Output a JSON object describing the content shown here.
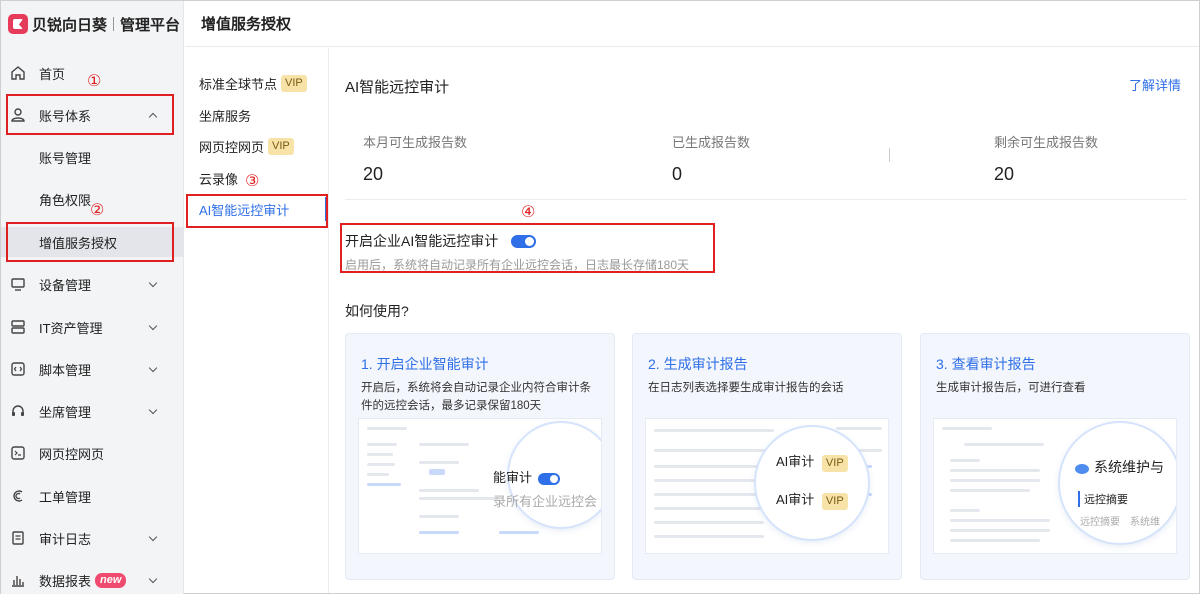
{
  "brand": {
    "name": "贝锐向日葵",
    "subtitle": "管理平台"
  },
  "header": {
    "title": "增值服务授权"
  },
  "sidebar": {
    "items": [
      {
        "label": "首页",
        "icon": "home-icon"
      },
      {
        "label": "账号体系",
        "icon": "user-icon",
        "expanded": true,
        "children": [
          "账号管理",
          "角色权限",
          "增值服务授权"
        ]
      },
      {
        "label": "设备管理",
        "icon": "monitor-icon"
      },
      {
        "label": "IT资产管理",
        "icon": "server-icon"
      },
      {
        "label": "脚本管理",
        "icon": "script-icon"
      },
      {
        "label": "坐席管理",
        "icon": "headset-icon"
      },
      {
        "label": "网页控网页",
        "icon": "terminal-icon"
      },
      {
        "label": "工单管理",
        "icon": "ticket-icon"
      },
      {
        "label": "审计日志",
        "icon": "document-icon"
      },
      {
        "label": "数据报表",
        "icon": "bar-chart-icon",
        "badge": "new"
      }
    ],
    "active_child": "增值服务授权"
  },
  "submenu": {
    "items": [
      {
        "label": "标准全球节点",
        "vip": "VIP"
      },
      {
        "label": "坐席服务"
      },
      {
        "label": "网页控网页",
        "vip": "VIP"
      },
      {
        "label": "云录像"
      },
      {
        "label": "AI智能远控审计",
        "active": true
      }
    ]
  },
  "main": {
    "section_title": "AI智能远控审计",
    "learn_more": "了解详情",
    "stats": [
      {
        "label": "本月可生成报告数",
        "value": "20"
      },
      {
        "label": "已生成报告数",
        "value": "0"
      },
      {
        "label": "剩余可生成报告数",
        "value": "20"
      }
    ],
    "toggle": {
      "label": "开启企业AI智能远控审计",
      "enabled": true,
      "description": "启用后，系统将自动记录所有企业远控会话，日志最长存储180天"
    },
    "howto_title": "如何使用?",
    "cards": [
      {
        "title": "1. 开启企业智能审计",
        "desc": "开启后，系统将会自动记录企业内符合审计条件的远控会话，最多记录保留180天",
        "zoom_text_1": "能审计",
        "zoom_text_2": "录所有企业远控会"
      },
      {
        "title": "2. 生成审计报告",
        "desc": "在日志列表选择要生成审计报告的会话",
        "zoom_text_1": "AI审计",
        "zoom_text_2": "AI审计",
        "vip": "VIP"
      },
      {
        "title": "3. 查看审计报告",
        "desc": "生成审计报告后，可进行查看",
        "zoom_text_1": "系统维护与",
        "zoom_text_2": "远控摘要",
        "zoom_text_3": "远控摘要",
        "zoom_text_4": "系统维"
      }
    ]
  },
  "annotations": [
    "①",
    "②",
    "③",
    "④"
  ],
  "colors": {
    "accent": "#2f6fe8",
    "annotation": "#e02020",
    "vip_bg": "#f7e2a8",
    "new_badge": "#ef4b6f"
  }
}
